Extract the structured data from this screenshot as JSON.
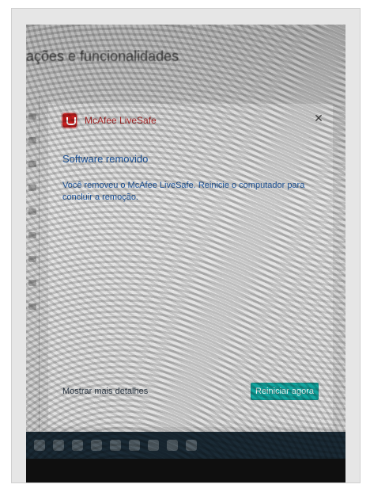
{
  "settings": {
    "header_text": "ações e funcionalidades"
  },
  "dialog": {
    "brand_label": "McAfee LiveSafe",
    "title": "Software removido",
    "body": "Você removeu o McAfee LiveSafe. Reinicie o computador para concluir a remoção.",
    "footer_link": "Mostrar mais detalhes",
    "primary_button": "Reiniciar agora"
  },
  "colors": {
    "title_blue": "#1e5aa6",
    "brand_red": "#c81f1f",
    "cta_teal": "#13a6a0",
    "taskbar": "#1a2a35"
  }
}
